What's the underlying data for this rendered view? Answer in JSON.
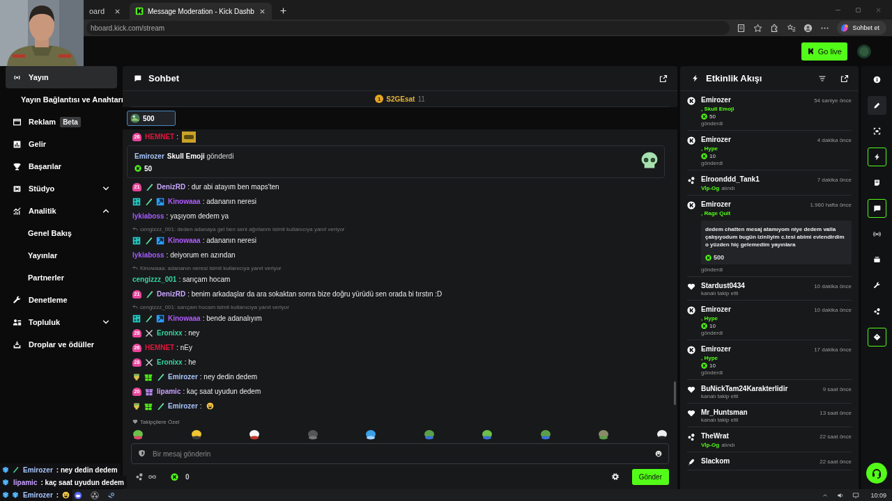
{
  "browser": {
    "tabs": [
      {
        "label": "oard",
        "selected": false
      },
      {
        "label": "Message Moderation - Kick Dashb",
        "selected": true
      }
    ],
    "url": "hboard.kick.com/stream",
    "assistant_button": "Sohbet et"
  },
  "header": {
    "go_live": "Go live"
  },
  "sidebar": {
    "items": [
      {
        "label": "Yayın",
        "selected": true,
        "children": [
          {
            "label": "Yayın Bağlantısı ve Anahtarı",
            "selected": false
          }
        ]
      },
      {
        "label": "Reklam",
        "badge": "Beta",
        "selected": false
      },
      {
        "label": "Gelir",
        "selected": false
      },
      {
        "label": "Başarılar",
        "selected": false
      },
      {
        "label": "Stüdyo",
        "selected": false,
        "expanded": false
      },
      {
        "label": "Analitik",
        "selected": false,
        "expanded": true,
        "children": [
          {
            "label": "Genel Bakış",
            "selected": false
          },
          {
            "label": "Yayınlar",
            "selected": false
          },
          {
            "label": "Partnerler",
            "selected": false
          }
        ]
      },
      {
        "label": "Denetleme",
        "selected": false
      },
      {
        "label": "Topluluk",
        "selected": false,
        "expanded": false
      },
      {
        "label": "Droplar ve ödüller",
        "selected": false
      }
    ]
  },
  "chat": {
    "title": "Sohbet",
    "pinned_gifter": {
      "rank": "1",
      "user": "S2GEsat",
      "count": "11"
    },
    "gift_chip": {
      "amount": "500"
    },
    "messages": [
      {
        "kind": "chat",
        "badges": [
          {
            "kind": "sub",
            "text": "26"
          }
        ],
        "user": "HEMNET",
        "color": "#e0173c",
        "text": ":",
        "emote": true
      },
      {
        "kind": "gift",
        "user": "Emirozer",
        "color": "#a9c7ff",
        "text": "**Skull Emoji** gönderdi",
        "amount": "50"
      },
      {
        "kind": "chat",
        "badges": [
          {
            "kind": "sub",
            "text": "21"
          },
          {
            "kind": "pen"
          }
        ],
        "user": "DenizRD",
        "color": "#c9a6ff",
        "text": ": dur abi atayım ben maps'ten",
        "emote": false
      },
      {
        "kind": "chat",
        "badges": [
          {
            "kind": "og"
          },
          {
            "kind": "pen"
          },
          {
            "kind": "hammer"
          }
        ],
        "user": "Kinowaaa",
        "color": "#b15cff",
        "text": ": adananın neresi",
        "emote": false
      },
      {
        "kind": "chat",
        "user": "lykiaboss",
        "color": "#a45dff",
        "text": ": yaşıyom dedem ya",
        "emote": false
      },
      {
        "kind": "chat",
        "reply": "cengizzz_001: deden adanaya gel ben seni ağırlarım isimli kullanıcıya yanıt veriyor",
        "badges": [
          {
            "kind": "og"
          },
          {
            "kind": "pen"
          },
          {
            "kind": "hammer"
          }
        ],
        "user": "Kinowaaa",
        "color": "#b15cff",
        "text": ": adananın neresi",
        "emote": false
      },
      {
        "kind": "chat",
        "user": "lykiaboss",
        "color": "#a45dff",
        "text": ": deiyorum en azından",
        "emote": false
      },
      {
        "kind": "chat",
        "reply": "Kinowaaa: adananın neresi isimli kullanıcıya yanıt veriyor",
        "user": "cengizzz_001",
        "color": "#35d6a0",
        "text": ": sarıçam hocam",
        "emote": false
      },
      {
        "kind": "chat",
        "badges": [
          {
            "kind": "sub",
            "text": "21"
          },
          {
            "kind": "pen"
          }
        ],
        "user": "DenizRD",
        "color": "#c9a6ff",
        "text": ": benim arkadaşlar da ara sokaktan sonra bize doğru yürüdü sen orada bi tırstın :D",
        "emote": false
      },
      {
        "kind": "chat",
        "reply": "cengizzz_001: sarıçam hocam isimli kullanıcıya yanıt veriyor",
        "badges": [
          {
            "kind": "og"
          },
          {
            "kind": "pen"
          },
          {
            "kind": "hammer"
          }
        ],
        "user": "Kinowaaa",
        "color": "#b15cff",
        "text": ": bende adanalıyım",
        "emote": false
      },
      {
        "kind": "chat",
        "badges": [
          {
            "kind": "sub",
            "text": "28"
          },
          {
            "kind": "swords"
          }
        ],
        "user": "Eronixx",
        "color": "#35d6a0",
        "text": ": ney",
        "emote": false
      },
      {
        "kind": "chat",
        "badges": [
          {
            "kind": "sub",
            "text": "26"
          }
        ],
        "user": "HEMNET",
        "color": "#e0173c",
        "text": ": nEy",
        "emote": false
      },
      {
        "kind": "chat",
        "badges": [
          {
            "kind": "sub",
            "text": "28"
          },
          {
            "kind": "swords"
          }
        ],
        "user": "Eronixx",
        "color": "#35d6a0",
        "text": ": he",
        "emote": false
      },
      {
        "kind": "chat",
        "badges": [
          {
            "kind": "trophy"
          },
          {
            "kind": "gift",
            "color": "#53fc18"
          },
          {
            "kind": "pen"
          }
        ],
        "user": "Emirozer",
        "color": "#a9c7ff",
        "text": ": ney dedin dedem",
        "emote": false
      },
      {
        "kind": "chat",
        "badges": [
          {
            "kind": "sub",
            "text": "20"
          },
          {
            "kind": "gift",
            "color": "#b98cf5"
          }
        ],
        "user": "lipamic",
        "color": "#c9a0ff",
        "text": ": kaç saat uyudun dedem",
        "emote": false
      },
      {
        "kind": "chat",
        "badges": [
          {
            "kind": "trophy"
          },
          {
            "kind": "gift",
            "color": "#53fc18"
          },
          {
            "kind": "pen"
          }
        ],
        "user": "Emirozer",
        "color": "#a9c7ff",
        "text": ":",
        "emote": true
      }
    ],
    "emote_bar": {
      "label": "Takipçilere Özel"
    },
    "input": {
      "placeholder": "Bir mesaj gönderin"
    },
    "balance": "0",
    "send": "Gönder"
  },
  "activity": {
    "title": "Etkinlik Akışı",
    "items": [
      {
        "kind": "kicks",
        "user": "Emirozer",
        "time": "54 saniye önce",
        "item": ", Skull Emoji",
        "amount": "50",
        "action": "gönderdi"
      },
      {
        "kind": "kicks",
        "user": "Emirozer",
        "time": "4 dakika önce",
        "item": ", Hype",
        "amount": "10",
        "action": "gönderdi"
      },
      {
        "kind": "vip",
        "user": "Elroonddd_Tank1",
        "time": "7 dakika önce",
        "reward": "Vİp-Og",
        "action": "alındı"
      },
      {
        "kind": "kicks",
        "user": "Emirozer",
        "time": "1.960 hafta önce",
        "item": ", Rage Quit",
        "message": "dedem chatten mesaj atamıyom niye dedem valla çalışıyodum bugün izinliyim c.tesi abimi evlendirdim o yüzden hiç gelemedim yayınlara",
        "amount": "500",
        "action": "gönderdi"
      },
      {
        "kind": "follow",
        "user": "Stardust0434",
        "time": "10 dakika önce",
        "action": "kanalı takip etti"
      },
      {
        "kind": "kicks",
        "user": "Emirozer",
        "time": "10 dakika önce",
        "item": ", Hype",
        "amount": "10",
        "action": "gönderdi"
      },
      {
        "kind": "kicks",
        "user": "Emirozer",
        "time": "17 dakika önce",
        "item": ", Hype",
        "amount": "10",
        "action": "gönderdi"
      },
      {
        "kind": "follow",
        "user": "BuNickTam24Karakterlidir",
        "time": "9 saat önce",
        "action": "kanalı takip etti"
      },
      {
        "kind": "follow",
        "user": "Mr_Huntsman",
        "time": "13 saat önce",
        "action": "kanalı takip etti"
      },
      {
        "kind": "vip",
        "user": "TheWrat",
        "time": "22 saat önce",
        "reward": "Vİp-Og",
        "action": "alındı"
      },
      {
        "kind": "other",
        "user": "Slackom",
        "time": "22 saat önce"
      }
    ]
  },
  "rail": [
    {
      "selected": false,
      "highlighted": false
    },
    {
      "selected": false,
      "highlighted": true
    },
    {
      "selected": false,
      "highlighted": false
    },
    {
      "selected": true,
      "highlighted": false
    },
    {
      "selected": false,
      "highlighted": false
    },
    {
      "selected": true,
      "highlighted": false
    },
    {
      "selected": false,
      "highlighted": false
    },
    {
      "selected": false,
      "highlighted": false
    },
    {
      "selected": false,
      "highlighted": false
    },
    {
      "selected": false,
      "highlighted": false
    },
    {
      "selected": true,
      "highlighted": false
    }
  ],
  "overlay_chat": [
    {
      "badges": [
        {
          "kind": "cube"
        },
        {
          "kind": "pen"
        }
      ],
      "user": "Emirozer",
      "color": "#a9c7ff",
      "text": ": ney dedin dedem",
      "emote": false
    },
    {
      "badges": [
        {
          "kind": "cube"
        }
      ],
      "user": "lipamic",
      "color": "#c9a0ff",
      "text": ": kaç saat uyudun dedem",
      "emote": false
    },
    {
      "badges": [
        {
          "kind": "cube"
        },
        {
          "kind": "cube"
        }
      ],
      "user": "Emirozer",
      "color": "#a9c7ff",
      "text": ":",
      "emote": true
    }
  ],
  "taskbar": {
    "clock": "10:09"
  }
}
